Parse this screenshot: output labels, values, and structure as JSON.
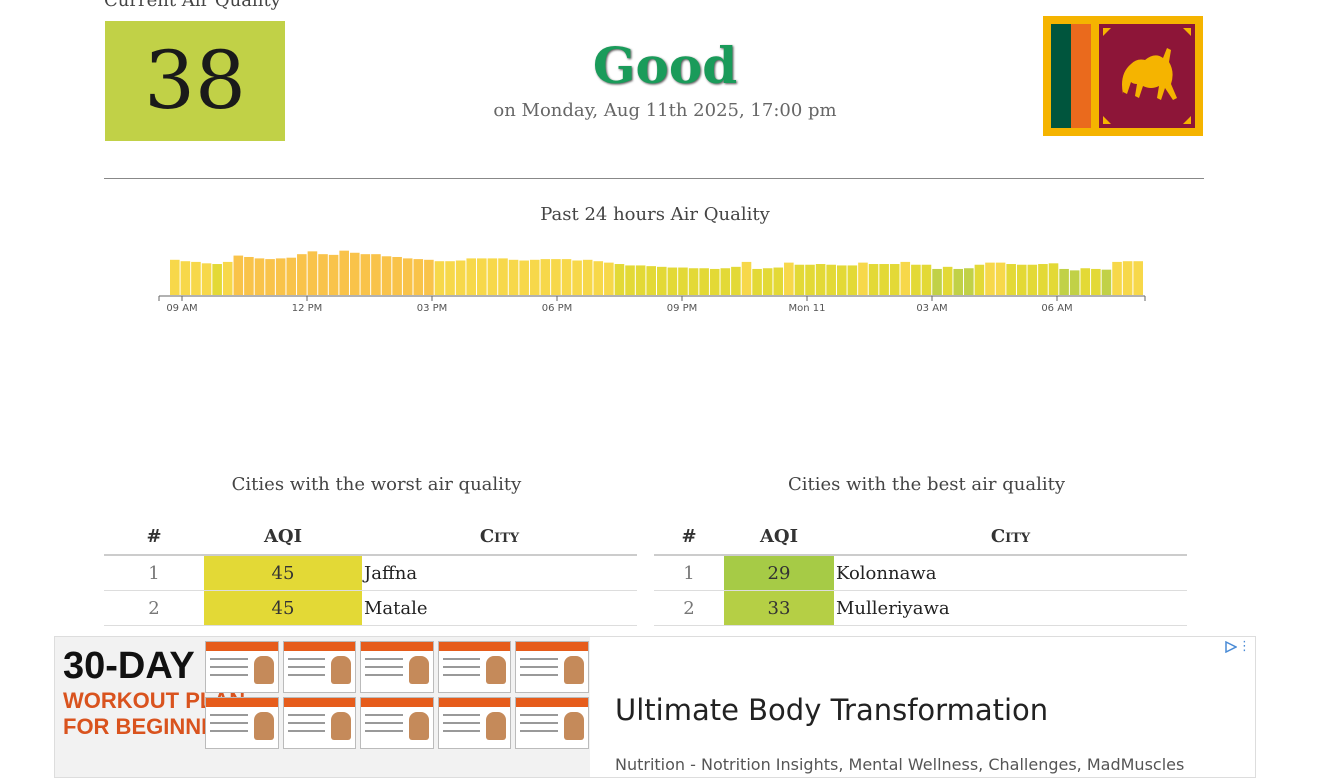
{
  "current": {
    "section_title": "Current Air Quality",
    "aqi": "38",
    "level": "Good",
    "timestamp": "on Monday, Aug 11th 2025, 17:00 pm"
  },
  "colors": {
    "good": "#c1d147",
    "level_text": "#1a9b5a",
    "moderate": "#e3d936",
    "yellow": "#f7d84a",
    "orange": "#f9c34a"
  },
  "chart_data": {
    "type": "bar",
    "title": "Past 24 hours Air Quality",
    "x_tick_labels": [
      "09 AM",
      "12 PM",
      "03 PM",
      "06 PM",
      "09 PM",
      "Mon 11",
      "03 AM",
      "06 AM"
    ],
    "values": [
      50,
      48,
      47,
      45,
      44,
      47,
      56,
      54,
      52,
      51,
      52,
      53,
      58,
      62,
      58,
      57,
      63,
      60,
      58,
      58,
      55,
      54,
      52,
      51,
      50,
      48,
      48,
      49,
      52,
      52,
      52,
      52,
      50,
      49,
      50,
      51,
      51,
      51,
      49,
      50,
      48,
      46,
      44,
      42,
      42,
      41,
      40,
      39,
      39,
      38,
      38,
      37,
      38,
      40,
      47,
      37,
      38,
      39,
      46,
      43,
      43,
      44,
      43,
      42,
      42,
      46,
      44,
      44,
      44,
      47,
      43,
      43,
      37,
      40,
      37,
      38,
      43,
      46,
      46,
      44,
      43,
      43,
      44,
      45,
      37,
      35,
      38,
      37,
      36,
      47,
      48,
      48
    ],
    "bar_colors": [
      "#f7d84a",
      "#f7d84a",
      "#f7d84a",
      "#f7d84a",
      "#e3d936",
      "#f7d84a",
      "#f9c34a",
      "#f9c34a",
      "#f9c34a",
      "#f9c34a",
      "#f9c34a",
      "#f9c34a",
      "#f9c34a",
      "#f9c34a",
      "#f9c34a",
      "#f9c34a",
      "#f9c34a",
      "#f9c34a",
      "#f9c34a",
      "#f9c34a",
      "#f9c34a",
      "#f9c34a",
      "#f9c34a",
      "#f9c34a",
      "#f9c34a",
      "#f7d84a",
      "#f7d84a",
      "#f7d84a",
      "#f7d84a",
      "#f7d84a",
      "#f7d84a",
      "#f7d84a",
      "#f7d84a",
      "#f7d84a",
      "#f7d84a",
      "#f7d84a",
      "#f7d84a",
      "#f7d84a",
      "#f7d84a",
      "#f7d84a",
      "#f7d84a",
      "#f7d84a",
      "#e3d936",
      "#e3d936",
      "#e3d936",
      "#e3d936",
      "#e3d936",
      "#e3d936",
      "#e3d936",
      "#e3d936",
      "#e3d936",
      "#e3d936",
      "#e3d936",
      "#e3d936",
      "#f7d84a",
      "#e3d936",
      "#e3d936",
      "#e3d936",
      "#f7d84a",
      "#e3d936",
      "#e3d936",
      "#e3d936",
      "#e3d936",
      "#e3d936",
      "#e3d936",
      "#f7d84a",
      "#e3d936",
      "#e3d936",
      "#e3d936",
      "#f7d84a",
      "#e3d936",
      "#e3d936",
      "#c1d147",
      "#e3d936",
      "#c1d147",
      "#c1d147",
      "#e3d936",
      "#f7d84a",
      "#f7d84a",
      "#e3d936",
      "#e3d936",
      "#e3d936",
      "#e3d936",
      "#e3d936",
      "#c1d147",
      "#c1d147",
      "#e3d936",
      "#e3d936",
      "#c1d147",
      "#f7d84a",
      "#f7d84a",
      "#f7d84a"
    ]
  },
  "worst": {
    "title": "Cities with the worst air quality",
    "headers": {
      "rank": "#",
      "aqi": "AQI",
      "city": "City"
    },
    "rows": [
      {
        "rank": "1",
        "aqi": "45",
        "city": "Jaffna",
        "color": "#e3d936"
      },
      {
        "rank": "2",
        "aqi": "45",
        "city": "Matale",
        "color": "#e3d936"
      }
    ]
  },
  "best": {
    "title": "Cities with the best air quality",
    "headers": {
      "rank": "#",
      "aqi": "AQI",
      "city": "City"
    },
    "rows": [
      {
        "rank": "1",
        "aqi": "29",
        "city": "Kolonnawa",
        "color": "#a6cb46"
      },
      {
        "rank": "2",
        "aqi": "33",
        "city": "Mulleriyawa",
        "color": "#b5cf45"
      }
    ]
  },
  "ad": {
    "brand_line1": "30-DAY",
    "brand_line2": "WORKOUT PLAN",
    "brand_line3": "FOR BEGINNERS",
    "headline": "Ultimate Body Transformation",
    "subline": "Nutrition - Notrition Insights, Mental Wellness, Challenges, MadMuscles",
    "menu_glyph": "⋮"
  }
}
